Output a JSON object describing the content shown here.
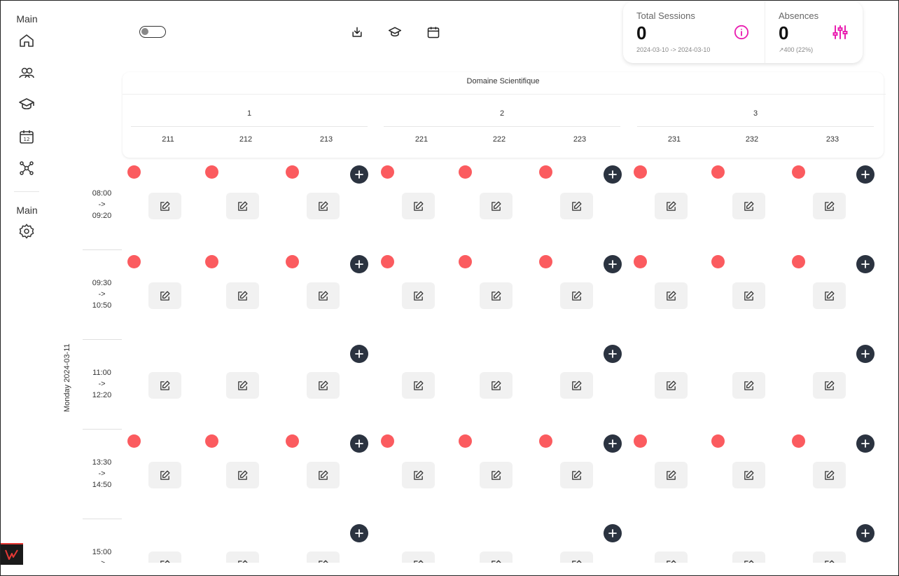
{
  "sidebar": {
    "section1_title": "Main",
    "section2_title": "Main",
    "icons": [
      "home-icon",
      "users-icon",
      "graduation-cap-icon",
      "calendar-icon",
      "network-icon",
      "settings-icon"
    ]
  },
  "header": {
    "toggle_state": "off",
    "icons": [
      "download-icon",
      "graduation-cap-icon",
      "calendar-icon"
    ]
  },
  "stats": {
    "total_sessions": {
      "label": "Total Sessions",
      "value": "0",
      "range": "2024-03-10 -> 2024-03-10",
      "icon": "info-icon",
      "icon_color": "#e91eb0"
    },
    "absences": {
      "label": "Absences",
      "value": "0",
      "sub": "↗400 (22%)",
      "icon": "sliders-icon",
      "icon_color": "#e91eb0"
    }
  },
  "schedule": {
    "domain": "Domaine Scientifique",
    "groups": [
      {
        "label": "1",
        "subgroups": [
          "211",
          "212",
          "213"
        ]
      },
      {
        "label": "2",
        "subgroups": [
          "221",
          "222",
          "223"
        ]
      },
      {
        "label": "3",
        "subgroups": [
          "231",
          "232",
          "233"
        ]
      }
    ],
    "day": "Monday 2024-03-11",
    "slots": [
      {
        "start": "08:00",
        "arrow": "->",
        "end": "09:20",
        "absent_marks": true
      },
      {
        "start": "09:30",
        "arrow": "->",
        "end": "10:50",
        "absent_marks": true
      },
      {
        "start": "11:00",
        "arrow": "->",
        "end": "12:20",
        "absent_marks": false
      },
      {
        "start": "13:30",
        "arrow": "->",
        "end": "14:50",
        "absent_marks": true
      },
      {
        "start": "15:00",
        "arrow": "->",
        "end": "",
        "absent_marks": false
      }
    ],
    "colors": {
      "absent_dot": "#fb5b5f",
      "add_button": "#2b3340",
      "edit_button": "#f1f1f1"
    }
  }
}
